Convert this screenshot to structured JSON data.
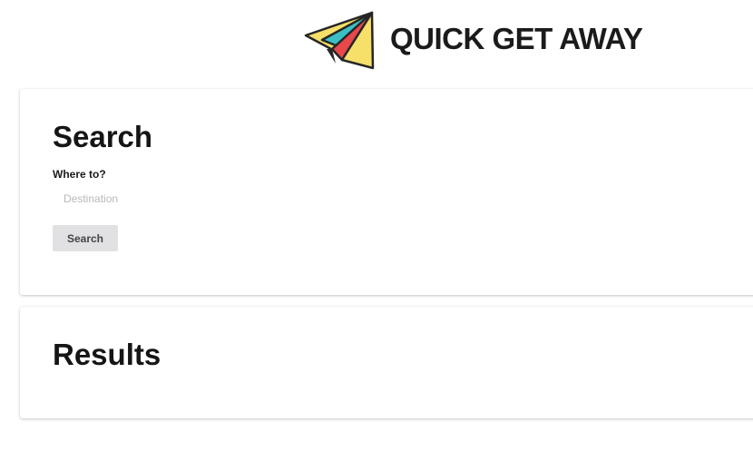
{
  "header": {
    "brand_title": "QUICK GET AWAY",
    "logo_icon": "paper-plane-icon",
    "logo_colors": {
      "yellow": "#F7E06A",
      "teal": "#3BBFC4",
      "red": "#E8474B",
      "outline": "#262626"
    }
  },
  "search_card": {
    "heading": "Search",
    "destination_label": "Where to?",
    "destination_placeholder": "Destination",
    "destination_value": "",
    "search_button_label": "Search"
  },
  "results_card": {
    "heading": "Results"
  }
}
